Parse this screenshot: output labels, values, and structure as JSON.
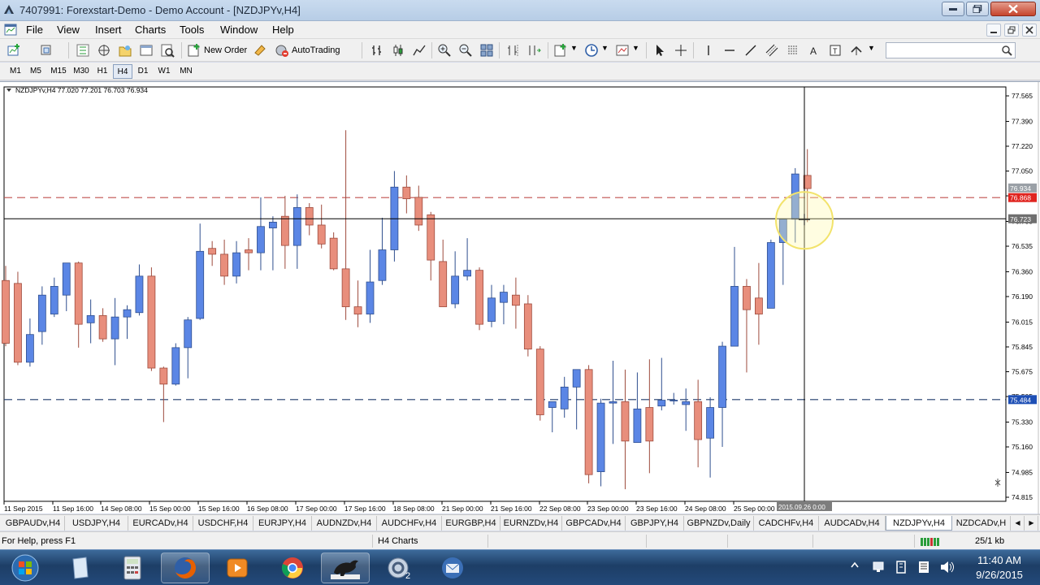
{
  "window": {
    "title": "7407991: Forexstart-Demo - Demo Account - [NZDJPYv,H4]"
  },
  "menu": [
    "File",
    "View",
    "Insert",
    "Charts",
    "Tools",
    "Window",
    "Help"
  ],
  "toolbar": {
    "new_order": "New Order",
    "auto_trading": "AutoTrading"
  },
  "timeframes": [
    "M1",
    "M5",
    "M15",
    "M30",
    "H1",
    "H4",
    "D1",
    "W1",
    "MN"
  ],
  "active_timeframe": "H4",
  "chart": {
    "header": "NZDJPYv,H4  77.020 77.201 76.703 76.934",
    "price_labels": [
      "77.565",
      "77.390",
      "77.220",
      "77.050",
      "76.880",
      "76.705",
      "76.535",
      "76.360",
      "76.190",
      "76.015",
      "75.845",
      "75.675",
      "75.505",
      "75.330",
      "75.160",
      "74.985",
      "74.815"
    ],
    "marker_ask": "76.934",
    "marker_line_upper": "76.868",
    "marker_crosshair": "76.723",
    "marker_line_lower": "75.484",
    "time_labels": [
      "11 Sep 2015",
      "11 Sep 16:00",
      "14 Sep 08:00",
      "15 Sep 00:00",
      "15 Sep 16:00",
      "16 Sep 08:00",
      "17 Sep 00:00",
      "17 Sep 16:00",
      "18 Sep 08:00",
      "21 Sep 00:00",
      "21 Sep 16:00",
      "22 Sep 08:00",
      "23 Sep 00:00",
      "23 Sep 16:00",
      "24 Sep 08:00",
      "25 Sep 00:00"
    ],
    "crosshair_time": "2015.09.26 0:00",
    "colors": {
      "bull": "#5b86e5",
      "bear": "#e88e7c",
      "hline_upper": "#c0504d",
      "hline_lower": "#1f3a6b",
      "marker_red": "#e0241f",
      "marker_blue": "#1e4fb5"
    }
  },
  "chart_data": {
    "type": "candlestick",
    "symbol": "NZDJPYv",
    "timeframe": "H4",
    "ylim": [
      74.815,
      77.565
    ],
    "candles": [
      {
        "o": 76.3,
        "h": 76.4,
        "l": 75.85,
        "c": 75.87
      },
      {
        "o": 76.28,
        "h": 76.36,
        "l": 75.72,
        "c": 75.74
      },
      {
        "o": 75.74,
        "h": 76.04,
        "l": 75.71,
        "c": 75.93
      },
      {
        "o": 75.95,
        "h": 76.26,
        "l": 75.86,
        "c": 76.2
      },
      {
        "o": 76.07,
        "h": 76.32,
        "l": 76.05,
        "c": 76.26
      },
      {
        "o": 76.2,
        "h": 76.42,
        "l": 76.09,
        "c": 76.42
      },
      {
        "o": 76.42,
        "h": 76.43,
        "l": 75.84,
        "c": 76.0
      },
      {
        "o": 76.01,
        "h": 76.17,
        "l": 75.87,
        "c": 76.06
      },
      {
        "o": 76.06,
        "h": 76.11,
        "l": 75.88,
        "c": 75.9
      },
      {
        "o": 75.9,
        "h": 76.18,
        "l": 75.72,
        "c": 76.05
      },
      {
        "o": 76.05,
        "h": 76.13,
        "l": 75.9,
        "c": 76.1
      },
      {
        "o": 76.08,
        "h": 76.41,
        "l": 76.06,
        "c": 76.33
      },
      {
        "o": 76.33,
        "h": 76.39,
        "l": 75.68,
        "c": 75.7
      },
      {
        "o": 75.7,
        "h": 75.71,
        "l": 75.33,
        "c": 75.59
      },
      {
        "o": 75.59,
        "h": 75.87,
        "l": 75.58,
        "c": 75.84
      },
      {
        "o": 75.84,
        "h": 76.05,
        "l": 75.63,
        "c": 76.03
      },
      {
        "o": 76.04,
        "h": 76.69,
        "l": 76.03,
        "c": 76.5
      },
      {
        "o": 76.52,
        "h": 76.57,
        "l": 76.4,
        "c": 76.48
      },
      {
        "o": 76.48,
        "h": 76.58,
        "l": 76.27,
        "c": 76.33
      },
      {
        "o": 76.33,
        "h": 76.57,
        "l": 76.28,
        "c": 76.49
      },
      {
        "o": 76.51,
        "h": 76.59,
        "l": 76.37,
        "c": 76.49
      },
      {
        "o": 76.49,
        "h": 76.87,
        "l": 76.37,
        "c": 76.67
      },
      {
        "o": 76.66,
        "h": 76.74,
        "l": 76.37,
        "c": 76.7
      },
      {
        "o": 76.74,
        "h": 76.88,
        "l": 76.38,
        "c": 76.54
      },
      {
        "o": 76.54,
        "h": 76.89,
        "l": 76.38,
        "c": 76.8
      },
      {
        "o": 76.8,
        "h": 76.83,
        "l": 76.61,
        "c": 76.68
      },
      {
        "o": 76.68,
        "h": 76.82,
        "l": 76.52,
        "c": 76.55
      },
      {
        "o": 76.59,
        "h": 76.63,
        "l": 76.37,
        "c": 76.38
      },
      {
        "o": 76.38,
        "h": 77.33,
        "l": 76.03,
        "c": 76.12
      },
      {
        "o": 76.12,
        "h": 76.3,
        "l": 75.98,
        "c": 76.07
      },
      {
        "o": 76.07,
        "h": 76.51,
        "l": 76.01,
        "c": 76.29
      },
      {
        "o": 76.3,
        "h": 76.73,
        "l": 76.27,
        "c": 76.51
      },
      {
        "o": 76.51,
        "h": 77.05,
        "l": 76.43,
        "c": 76.94
      },
      {
        "o": 76.94,
        "h": 77.02,
        "l": 76.76,
        "c": 76.86
      },
      {
        "o": 76.87,
        "h": 76.95,
        "l": 76.64,
        "c": 76.68
      },
      {
        "o": 76.75,
        "h": 76.77,
        "l": 76.3,
        "c": 76.44
      },
      {
        "o": 76.43,
        "h": 76.58,
        "l": 76.13,
        "c": 76.12
      },
      {
        "o": 76.14,
        "h": 76.5,
        "l": 76.11,
        "c": 76.33
      },
      {
        "o": 76.33,
        "h": 76.59,
        "l": 76.3,
        "c": 76.37
      },
      {
        "o": 76.37,
        "h": 76.39,
        "l": 75.96,
        "c": 76.0
      },
      {
        "o": 76.02,
        "h": 76.27,
        "l": 75.98,
        "c": 76.18
      },
      {
        "o": 76.15,
        "h": 76.27,
        "l": 76.0,
        "c": 76.22
      },
      {
        "o": 76.2,
        "h": 76.32,
        "l": 75.97,
        "c": 76.13
      },
      {
        "o": 76.14,
        "h": 76.2,
        "l": 75.78,
        "c": 75.83
      },
      {
        "o": 75.83,
        "h": 75.85,
        "l": 75.34,
        "c": 75.38
      },
      {
        "o": 75.43,
        "h": 75.46,
        "l": 75.26,
        "c": 75.47
      },
      {
        "o": 75.42,
        "h": 75.64,
        "l": 75.36,
        "c": 75.57
      },
      {
        "o": 75.57,
        "h": 75.68,
        "l": 75.28,
        "c": 75.69
      },
      {
        "o": 75.69,
        "h": 75.72,
        "l": 74.91,
        "c": 74.97
      },
      {
        "o": 74.99,
        "h": 75.49,
        "l": 74.89,
        "c": 75.46
      },
      {
        "o": 75.46,
        "h": 75.75,
        "l": 75.18,
        "c": 75.47
      },
      {
        "o": 75.47,
        "h": 75.69,
        "l": 74.87,
        "c": 75.2
      },
      {
        "o": 75.19,
        "h": 75.67,
        "l": 75.19,
        "c": 75.42
      },
      {
        "o": 75.43,
        "h": 75.76,
        "l": 74.98,
        "c": 75.2
      },
      {
        "o": 75.44,
        "h": 75.77,
        "l": 75.41,
        "c": 75.48
      },
      {
        "o": 75.48,
        "h": 75.53,
        "l": 75.45,
        "c": 75.48
      },
      {
        "o": 75.45,
        "h": 75.56,
        "l": 75.27,
        "c": 75.47
      },
      {
        "o": 75.47,
        "h": 75.62,
        "l": 75.02,
        "c": 75.21
      },
      {
        "o": 75.22,
        "h": 75.5,
        "l": 74.95,
        "c": 75.43
      },
      {
        "o": 75.43,
        "h": 75.88,
        "l": 75.16,
        "c": 75.85
      },
      {
        "o": 75.85,
        "h": 76.53,
        "l": 75.86,
        "c": 76.26
      },
      {
        "o": 76.26,
        "h": 76.31,
        "l": 75.67,
        "c": 76.1
      },
      {
        "o": 76.18,
        "h": 76.42,
        "l": 75.86,
        "c": 76.07
      },
      {
        "o": 76.11,
        "h": 76.58,
        "l": 76.13,
        "c": 76.56
      },
      {
        "o": 76.56,
        "h": 76.72,
        "l": 76.27,
        "c": 76.72
      },
      {
        "o": 76.72,
        "h": 77.07,
        "l": 76.56,
        "c": 77.03
      },
      {
        "o": 77.02,
        "h": 77.2,
        "l": 76.7,
        "c": 76.93
      }
    ]
  },
  "tabs": [
    "GBPAUDv,H4",
    "USDJPY,H4",
    "EURCADv,H4",
    "USDCHF,H4",
    "EURJPY,H4",
    "AUDNZDv,H4",
    "AUDCHFv,H4",
    "EURGBP,H4",
    "EURNZDv,H4",
    "GBPCADv,H4",
    "GBPJPY,H4",
    "GBPNZDv,Daily",
    "CADCHFv,H4",
    "AUDCADv,H4",
    "NZDJPYv,H4",
    "NZDCADv,H"
  ],
  "active_tab": "NZDJPYv,H4",
  "status": {
    "help": "For Help, press F1",
    "profile": "H4 Charts",
    "traffic": "25/1 kb"
  },
  "clock": {
    "time": "11:40 AM",
    "date": "9/26/2015"
  }
}
